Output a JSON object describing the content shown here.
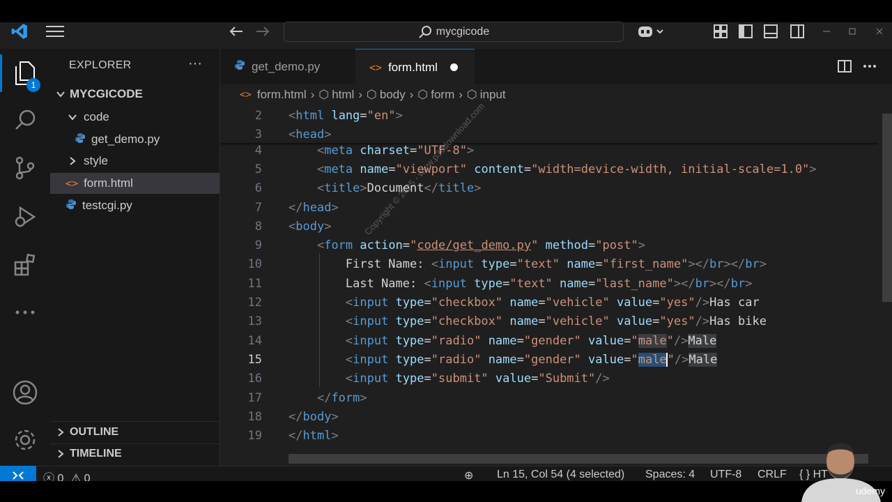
{
  "window": {
    "search_text": "mycgicode"
  },
  "activity": {
    "explorer_badge": "1"
  },
  "sidebar": {
    "header": "EXPLORER",
    "more": "···",
    "root": "MYCGICODE",
    "items": [
      {
        "label": "code"
      },
      {
        "label": "get_demo.py"
      },
      {
        "label": "style"
      },
      {
        "label": "form.html"
      },
      {
        "label": "testcgi.py"
      }
    ],
    "outline": "OUTLINE",
    "timeline": "TIMELINE"
  },
  "tabs": [
    {
      "label": "get_demo.py"
    },
    {
      "label": "form.html"
    }
  ],
  "breadcrumb": [
    "form.html",
    "html",
    "body",
    "form",
    "input"
  ],
  "editor": {
    "line_numbers": [
      "2",
      "3",
      "4",
      "5",
      "6",
      "7",
      "8",
      "9",
      "10",
      "11",
      "12",
      "13",
      "14",
      "15",
      "16",
      "17",
      "18",
      "19"
    ]
  },
  "status": {
    "errors": "0",
    "warnings": "0",
    "position": "Ln 15, Col 54 (4 selected)",
    "spaces": "Spaces: 4",
    "encoding": "UTF-8",
    "eol": "CRLF",
    "lang": "{ } HT"
  },
  "overlay": {
    "watermark": "Copyright © 2025 - www.p30download.com",
    "udemy": "udemy"
  },
  "colors": {
    "accent": "#0078d4",
    "tag": "#569cd6",
    "attr": "#9cdcfe",
    "string": "#ce9178"
  }
}
